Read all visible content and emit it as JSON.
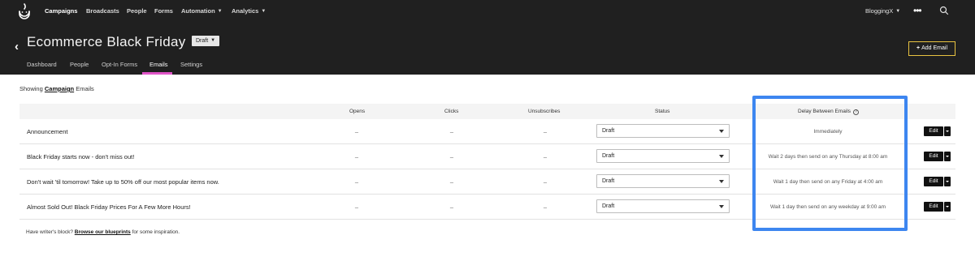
{
  "nav": {
    "items": [
      "Campaigns",
      "Broadcasts",
      "People",
      "Forms",
      "Automation",
      "Analytics"
    ],
    "account": "BloggingX"
  },
  "header": {
    "title": "Ecommerce Black Friday",
    "status": "Draft",
    "tabs": [
      "Dashboard",
      "People",
      "Opt-In Forms",
      "Emails",
      "Settings"
    ],
    "active_tab": "Emails",
    "add_email_label": "Add Email"
  },
  "content": {
    "showing_prefix": "Showing",
    "showing_link": "Campaign",
    "showing_suffix": "Emails",
    "columns": {
      "opens": "Opens",
      "clicks": "Clicks",
      "unsubscribes": "Unsubscribes",
      "status": "Status",
      "delay": "Delay Between Emails"
    },
    "edit_label": "Edit",
    "rows": [
      {
        "name": "Announcement",
        "opens": "–",
        "clicks": "–",
        "unsubscribes": "–",
        "status": "Draft",
        "delay": "Immediately"
      },
      {
        "name": "Black Friday starts now - don't miss out!",
        "opens": "–",
        "clicks": "–",
        "unsubscribes": "–",
        "status": "Draft",
        "delay": "Wait 2 days then send on any Thursday at 8:00 am"
      },
      {
        "name": "Don't wait 'til tomorrow! Take up to 50% off our most popular items now.",
        "opens": "–",
        "clicks": "–",
        "unsubscribes": "–",
        "status": "Draft",
        "delay": "Wait 1 day then send on any Friday at 4:00 am"
      },
      {
        "name": "Almost Sold Out! Black Friday Prices For A Few More Hours!",
        "opens": "–",
        "clicks": "–",
        "unsubscribes": "–",
        "status": "Draft",
        "delay": "Wait 1 day then send on any weekday at 9:00 am"
      }
    ],
    "footer_prefix": "Have writer's block?",
    "footer_link": "Browse our blueprints",
    "footer_suffix": "for some inspiration."
  },
  "colors": {
    "nav_bg": "#202020",
    "tab_accent": "#e055c8",
    "add_email_border": "#e8c341",
    "highlight": "#3d86f0"
  }
}
